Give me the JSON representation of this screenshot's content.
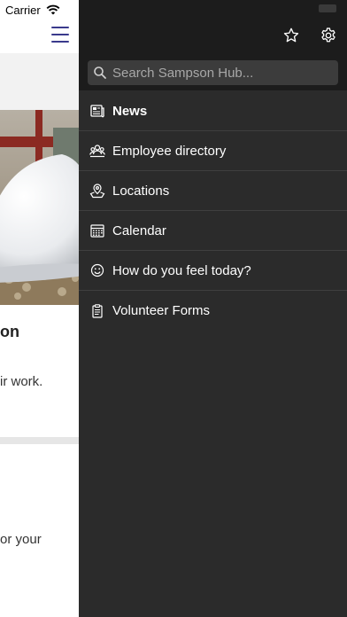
{
  "status_bar": {
    "carrier": "Carrier"
  },
  "drawer": {
    "search_placeholder": "Search Sampson Hub...",
    "items": [
      {
        "label": "News",
        "icon": "news-icon",
        "active": true
      },
      {
        "label": "Employee directory",
        "icon": "people-icon"
      },
      {
        "label": "Locations",
        "icon": "map-pin-icon"
      },
      {
        "label": "Calendar",
        "icon": "calendar-icon"
      },
      {
        "label": "How do you feel today?",
        "icon": "smiley-icon"
      },
      {
        "label": "Volunteer Forms",
        "icon": "clipboard-icon"
      }
    ]
  },
  "background": {
    "article_title_fragment": "on",
    "article_text_fragment": "ir work.",
    "second_text_fragment": "or your"
  },
  "colors": {
    "drawer_bg": "#2b2b2b",
    "drawer_header_bg": "#1c1c1c",
    "accent": "#3a3a8c"
  }
}
